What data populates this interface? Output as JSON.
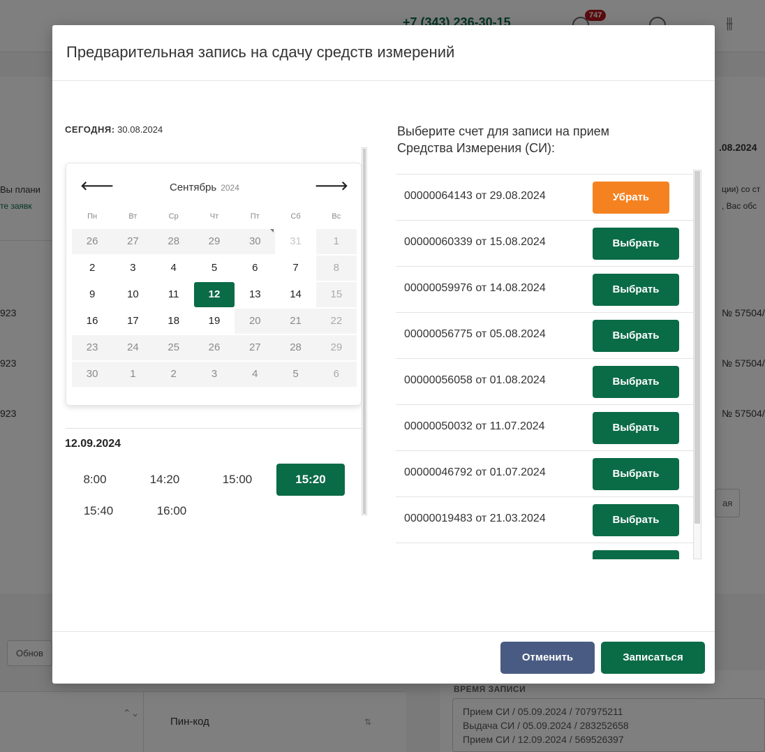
{
  "background": {
    "phone": "+7 (343) 236-30-15",
    "notifications_count": "747",
    "left_snippets": [
      "Вы плани",
      "те заявк",
      "923",
      "923",
      "923"
    ],
    "refresh_label": "Обнов",
    "pin_header": "Пин-код",
    "right_date": ".08.2024",
    "right_snippets": [
      "ции) со ст",
      ", Вас обс",
      "№ 57504/",
      "№ 57504/",
      "№ 57504/",
      "ая"
    ],
    "booking_time_label": "ВРЕМЯ ЗАПИСИ",
    "booking_time_lines": [
      "Прием СИ / 05.09.2024 / 707975211",
      "Выдача СИ / 05.09.2024 / 283252658",
      "Прием СИ / 12.09.2024 / 569526397"
    ]
  },
  "modal": {
    "title": "Предварительная запись на сдачу средств измерений",
    "today_label": "СЕГОДНЯ:",
    "today_value": "30.08.2024",
    "calendar": {
      "month": "Сентябрь",
      "year": "2024",
      "weekdays": [
        "Пн",
        "Вт",
        "Ср",
        "Чт",
        "Пт",
        "Сб",
        "Вс"
      ],
      "days": [
        "26",
        "27",
        "28",
        "29",
        "30",
        "31",
        "1",
        "2",
        "3",
        "4",
        "5",
        "6",
        "7",
        "8",
        "9",
        "10",
        "11",
        "12",
        "13",
        "14",
        "15",
        "16",
        "17",
        "18",
        "19",
        "20",
        "21",
        "22",
        "23",
        "24",
        "25",
        "26",
        "27",
        "28",
        "29",
        "30",
        "1",
        "2",
        "3",
        "4",
        "5",
        "6"
      ],
      "selected_day": "12"
    },
    "selected_date": "12.09.2024",
    "time_slots": [
      "8:00",
      "14:20",
      "15:00",
      "15:20",
      "15:40",
      "16:00"
    ],
    "selected_slot": "15:20",
    "invoices_title_line1": "Выберите счет для записи на прием",
    "invoices_title_line2": "Средства Измерения (СИ):",
    "invoices": [
      {
        "label": "00000064143 от 29.08.2024",
        "action": "Убрать",
        "state": "selected"
      },
      {
        "label": "00000060339 от 15.08.2024",
        "action": "Выбрать",
        "state": "available"
      },
      {
        "label": "00000059976 от 14.08.2024",
        "action": "Выбрать",
        "state": "available"
      },
      {
        "label": "00000056775 от 05.08.2024",
        "action": "Выбрать",
        "state": "available"
      },
      {
        "label": "00000056058 от 01.08.2024",
        "action": "Выбрать",
        "state": "available"
      },
      {
        "label": "00000050032 от 11.07.2024",
        "action": "Выбрать",
        "state": "available"
      },
      {
        "label": "00000046792 от 01.07.2024",
        "action": "Выбрать",
        "state": "available"
      },
      {
        "label": "00000019483 от 21.03.2024",
        "action": "Выбрать",
        "state": "available"
      }
    ],
    "cancel_label": "Отменить",
    "submit_label": "Записаться"
  },
  "colors": {
    "primary_green": "#0a6b47",
    "remove_orange": "#f58220",
    "cancel_slate": "#4a5b83",
    "badge_red": "#b5191f"
  }
}
